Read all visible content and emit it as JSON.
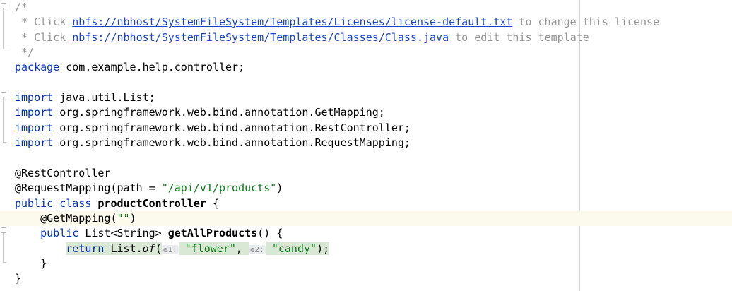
{
  "editor": {
    "lines": [
      {
        "parts": [
          {
            "t": "/*",
            "c": "cmt"
          }
        ]
      },
      {
        "parts": [
          {
            "t": " * Click ",
            "c": "cmt"
          },
          {
            "t": "nbfs://nbhost/SystemFileSystem/Templates/Licenses/license-default.txt",
            "c": "link"
          },
          {
            "t": " to change this license",
            "c": "cmt"
          }
        ]
      },
      {
        "parts": [
          {
            "t": " * Click ",
            "c": "cmt"
          },
          {
            "t": "nbfs://nbhost/SystemFileSystem/Templates/Classes/Class.java",
            "c": "link"
          },
          {
            "t": " to edit this template",
            "c": "cmt"
          }
        ]
      },
      {
        "parts": [
          {
            "t": " */",
            "c": "cmt"
          }
        ]
      },
      {
        "parts": [
          {
            "t": "package",
            "c": "kw"
          },
          {
            "t": " com.example.help.controller;",
            "c": ""
          }
        ]
      },
      {
        "parts": []
      },
      {
        "parts": [
          {
            "t": "import",
            "c": "kw"
          },
          {
            "t": " java.util.List;",
            "c": ""
          }
        ]
      },
      {
        "parts": [
          {
            "t": "import",
            "c": "kw"
          },
          {
            "t": " org.springframework.web.bind.annotation.GetMapping;",
            "c": ""
          }
        ]
      },
      {
        "parts": [
          {
            "t": "import",
            "c": "kw"
          },
          {
            "t": " org.springframework.web.bind.annotation.RestController;",
            "c": ""
          }
        ]
      },
      {
        "parts": [
          {
            "t": "import",
            "c": "kw"
          },
          {
            "t": " org.springframework.web.bind.annotation.RequestMapping;",
            "c": ""
          }
        ]
      },
      {
        "parts": []
      },
      {
        "parts": [
          {
            "t": "@RestController",
            "c": ""
          }
        ]
      },
      {
        "parts": [
          {
            "t": "@RequestMapping(path = ",
            "c": ""
          },
          {
            "t": "\"/api/v1/products\"",
            "c": "str"
          },
          {
            "t": ")",
            "c": ""
          }
        ]
      },
      {
        "parts": [
          {
            "t": "public",
            "c": "kw"
          },
          {
            "t": " ",
            "c": ""
          },
          {
            "t": "class",
            "c": "kw"
          },
          {
            "t": " ",
            "c": ""
          },
          {
            "t": "productController",
            "c": "bold"
          },
          {
            "t": " {",
            "c": ""
          }
        ]
      },
      {
        "current": true,
        "parts": [
          {
            "t": "    @GetMapping(",
            "c": ""
          },
          {
            "t": "\"\"",
            "c": "str"
          },
          {
            "t": ")",
            "c": ""
          }
        ]
      },
      {
        "parts": [
          {
            "t": "    ",
            "c": ""
          },
          {
            "t": "public",
            "c": "kw"
          },
          {
            "t": " List<String> ",
            "c": ""
          },
          {
            "t": "getAllProducts",
            "c": "bold"
          },
          {
            "t": "() {",
            "c": ""
          }
        ]
      },
      {
        "parts": [
          {
            "t": "        ",
            "c": ""
          },
          {
            "t": "return",
            "c": "kw hl"
          },
          {
            "t": " List.",
            "c": "hl"
          },
          {
            "t": "of",
            "c": "it hl"
          },
          {
            "t": "(",
            "c": "hl"
          },
          {
            "t": "e1:",
            "c": "hint"
          },
          {
            "t": " ",
            "c": "hl"
          },
          {
            "t": "\"flower\"",
            "c": "str hl"
          },
          {
            "t": ", ",
            "c": "hl"
          },
          {
            "t": "e2:",
            "c": "hint"
          },
          {
            "t": " ",
            "c": "hl"
          },
          {
            "t": "\"candy\"",
            "c": "str hl"
          },
          {
            "t": ");",
            "c": "hl"
          }
        ]
      },
      {
        "parts": [
          {
            "t": "    }",
            "c": ""
          }
        ]
      },
      {
        "parts": [
          {
            "t": "}",
            "c": ""
          }
        ]
      }
    ]
  }
}
